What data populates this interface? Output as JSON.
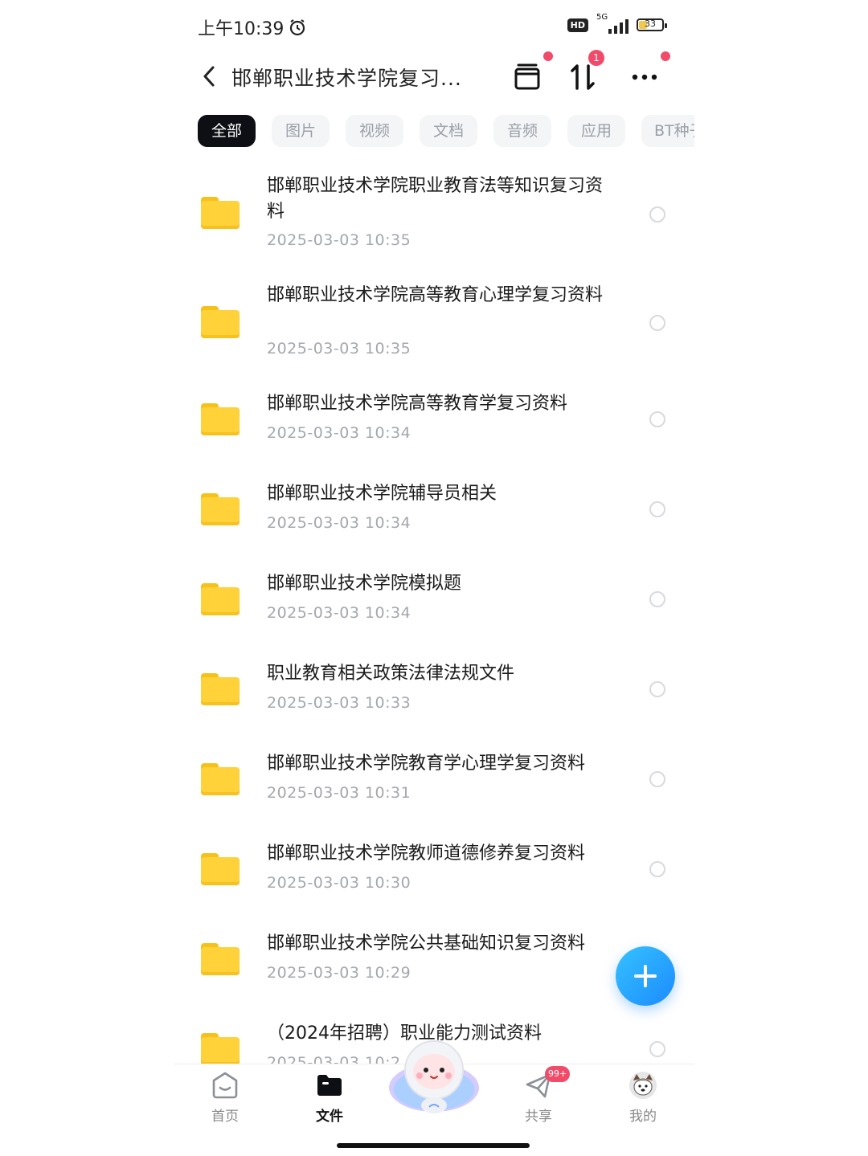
{
  "status_bar": {
    "time": "上午10:39",
    "hd": "HD",
    "network": "5G",
    "battery": "33"
  },
  "header": {
    "title": "邯郸职业技术学院复习...",
    "transfer_badge": "1"
  },
  "tabs": [
    "全部",
    "图片",
    "视频",
    "文档",
    "音频",
    "应用",
    "BT种子"
  ],
  "files": [
    {
      "name": "邯郸职业技术学院职业教育法等知识复习资料",
      "date": "2025-03-03  10:35"
    },
    {
      "name": "邯郸职业技术学院高等教育心理学复习资料",
      "date": "2025-03-03  10:35"
    },
    {
      "name": "邯郸职业技术学院高等教育学复习资料",
      "date": "2025-03-03  10:34"
    },
    {
      "name": "邯郸职业技术学院辅导员相关",
      "date": "2025-03-03  10:34"
    },
    {
      "name": "邯郸职业技术学院模拟题",
      "date": "2025-03-03  10:34"
    },
    {
      "name": "职业教育相关政策法律法规文件",
      "date": "2025-03-03  10:33"
    },
    {
      "name": "邯郸职业技术学院教育学心理学复习资料",
      "date": "2025-03-03  10:31"
    },
    {
      "name": "邯郸职业技术学院教师道德修养复习资料",
      "date": "2025-03-03  10:30"
    },
    {
      "name": "邯郸职业技术学院公共基础知识复习资料",
      "date": "2025-03-03  10:29"
    },
    {
      "name": "（2024年招聘）职业能力测试资料",
      "date": "2025-03-03  10:2"
    }
  ],
  "nav": {
    "home": "首页",
    "files": "文件",
    "share": "共享",
    "share_badge": "99+",
    "mine": "我的"
  },
  "colors": {
    "accent": "#1b8bff",
    "folder": "#ffd23a",
    "badge": "#f24b6a"
  }
}
